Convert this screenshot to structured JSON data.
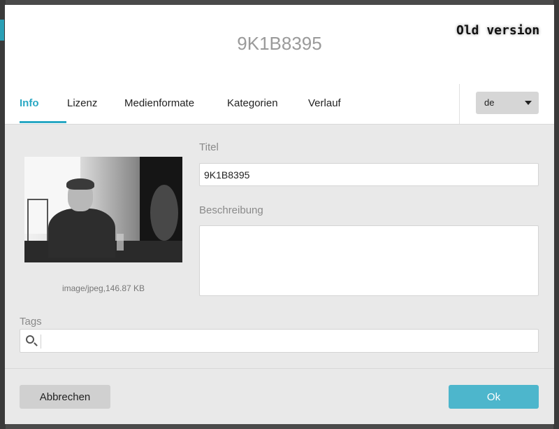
{
  "modal": {
    "title": "9K1B8395",
    "overlay_note": "Old version"
  },
  "tabs": [
    {
      "label": "Info",
      "active": true
    },
    {
      "label": "Lizenz",
      "active": false
    },
    {
      "label": "Medienformate",
      "active": false
    },
    {
      "label": "Kategorien",
      "active": false
    },
    {
      "label": "Verlauf",
      "active": false
    }
  ],
  "language": {
    "selected": "de"
  },
  "media": {
    "mime_info": "image/jpeg,146.87 KB"
  },
  "fields": {
    "title_label": "Titel",
    "title_value": "9K1B8395",
    "description_label": "Beschreibung",
    "description_value": "",
    "tags_label": "Tags",
    "tags_value": ""
  },
  "footer": {
    "cancel_label": "Abbrechen",
    "ok_label": "Ok"
  },
  "colors": {
    "accent": "#2aa8c4",
    "ok_button": "#4db6cc",
    "cancel_button": "#d0d0d0",
    "panel": "#e9e9e9"
  },
  "icons": {
    "tags_search": "search-icon",
    "language_dropdown": "chevron-down-icon"
  }
}
